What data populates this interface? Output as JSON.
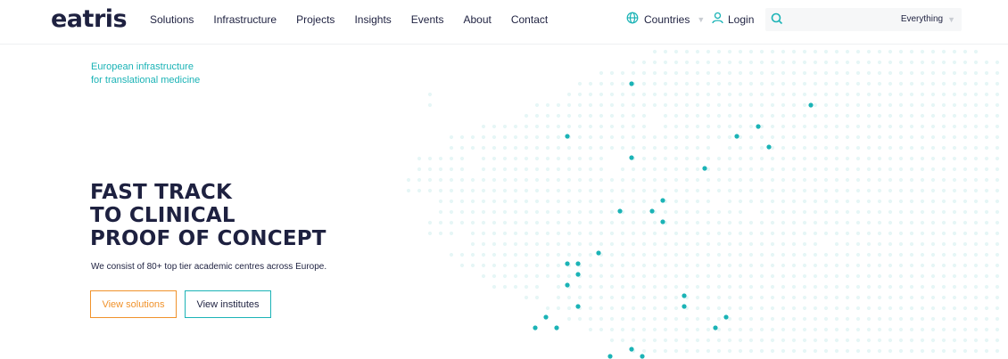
{
  "brand": {
    "logo_text": "eatris",
    "accent_color": "#1bb3b6",
    "navy_color": "#1e2140",
    "orange_color": "#f0922b"
  },
  "nav": {
    "items": [
      "Solutions",
      "Infrastructure",
      "Projects",
      "Insights",
      "Events",
      "About",
      "Contact"
    ]
  },
  "header_right": {
    "countries_label": "Countries",
    "login_label": "Login",
    "search_placeholder": "",
    "search_scope": "Everything"
  },
  "hero": {
    "tagline_line1": "European infrastructure",
    "tagline_line2": "for translational medicine",
    "headline_line1": "FAST TRACK",
    "headline_line2": "TO CLINICAL",
    "headline_line3": "PROOF OF CONCEPT",
    "subtext": "We consist of 80+ top tier academic centres across Europe.",
    "button_solutions": "View solutions",
    "button_institutes": "View institutes"
  },
  "icons": {
    "countries": "globe-icon",
    "login": "user-icon",
    "search": "search-icon",
    "dropdown": "chevron-down-icon"
  }
}
